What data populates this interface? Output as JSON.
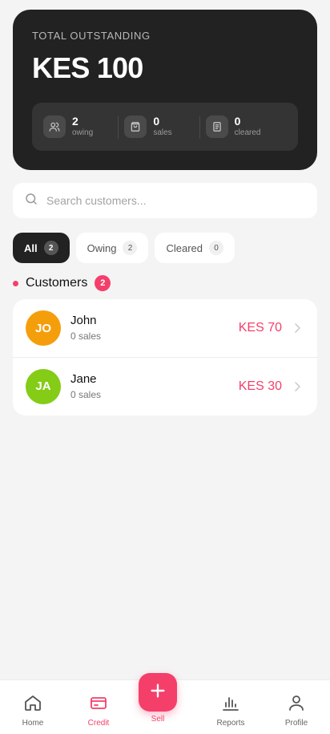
{
  "summary": {
    "label": "TOTAL OUTSTANDING",
    "amount": "KES 100",
    "stats": [
      {
        "value": "2",
        "label": "owing",
        "icon": "users-icon"
      },
      {
        "value": "0",
        "label": "sales",
        "icon": "shopping-bag-icon"
      },
      {
        "value": "0",
        "label": "cleared",
        "icon": "receipt-icon"
      }
    ]
  },
  "search": {
    "placeholder": "Search customers..."
  },
  "tabs": [
    {
      "label": "All",
      "count": "2",
      "active": true
    },
    {
      "label": "Owing",
      "count": "2",
      "active": false
    },
    {
      "label": "Cleared",
      "count": "0",
      "active": false
    }
  ],
  "section": {
    "title": "Customers",
    "count": "2"
  },
  "customers": [
    {
      "initials": "JO",
      "name": "John",
      "sub": "0 sales",
      "amount": "KES 70",
      "avatar_color": "#f59e0b"
    },
    {
      "initials": "JA",
      "name": "Jane",
      "sub": "0 sales",
      "amount": "KES 30",
      "avatar_color": "#84cc16"
    }
  ],
  "nav": {
    "home": "Home",
    "credit": "Credit",
    "sell": "Sell",
    "reports": "Reports",
    "profile": "Profile"
  },
  "colors": {
    "accent": "#f43f6a",
    "card": "#222222"
  }
}
